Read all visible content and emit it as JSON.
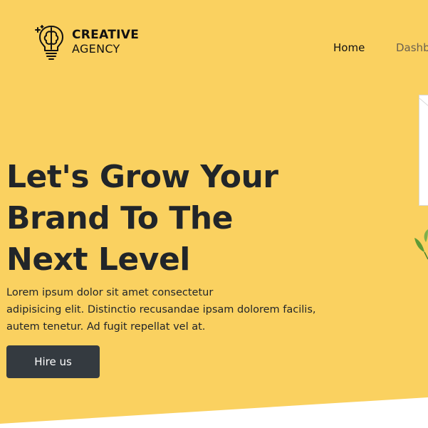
{
  "brand": {
    "name_line1": "CREATIVE",
    "name_line2": "AGENCY",
    "icon": "lightbulb-brain-icon"
  },
  "nav": {
    "items": [
      {
        "label": "Home"
      },
      {
        "label": "Dashb"
      }
    ]
  },
  "hero": {
    "headline_lines": [
      "Let's Grow Your",
      "Brand To The",
      "Next Level"
    ],
    "description_lines": [
      "Lorem ipsum dolor sit amet consectetur",
      "adipisicing elit. Distinctio recusandae ipsam dolorem facilis,",
      "autem tenetur. Ad fugit repellat vel at."
    ],
    "cta_label": "Hire us"
  },
  "colors": {
    "hero_background": "#fad160",
    "page_background": "#ffffff",
    "button_background": "#343a40",
    "text_dark": "#212529"
  }
}
